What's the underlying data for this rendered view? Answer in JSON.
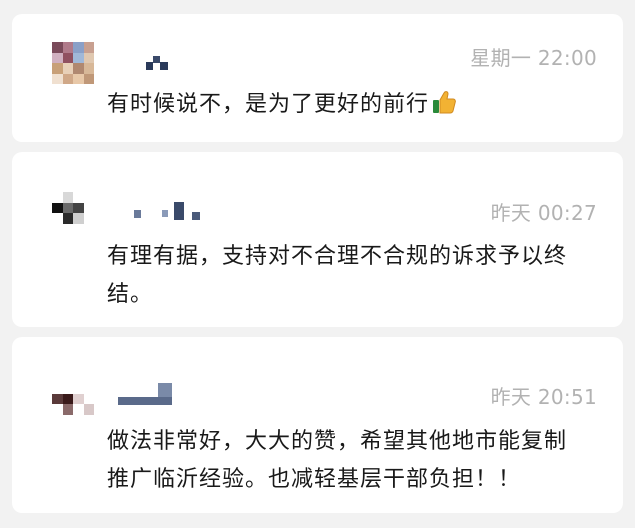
{
  "comments": [
    {
      "time": "星期一 22:00",
      "text": "有时候说不，是为了更好的前行",
      "emoji": "thumbs-up-emoji"
    },
    {
      "time": "昨天 00:27",
      "text": "有理有据，支持对不合理不合规的诉求予以终结。"
    },
    {
      "time": "昨天 20:51",
      "text": "做法非常好，大大的赞，希望其他地市能复制推广临沂经验。也减轻基层干部负担！！"
    }
  ]
}
